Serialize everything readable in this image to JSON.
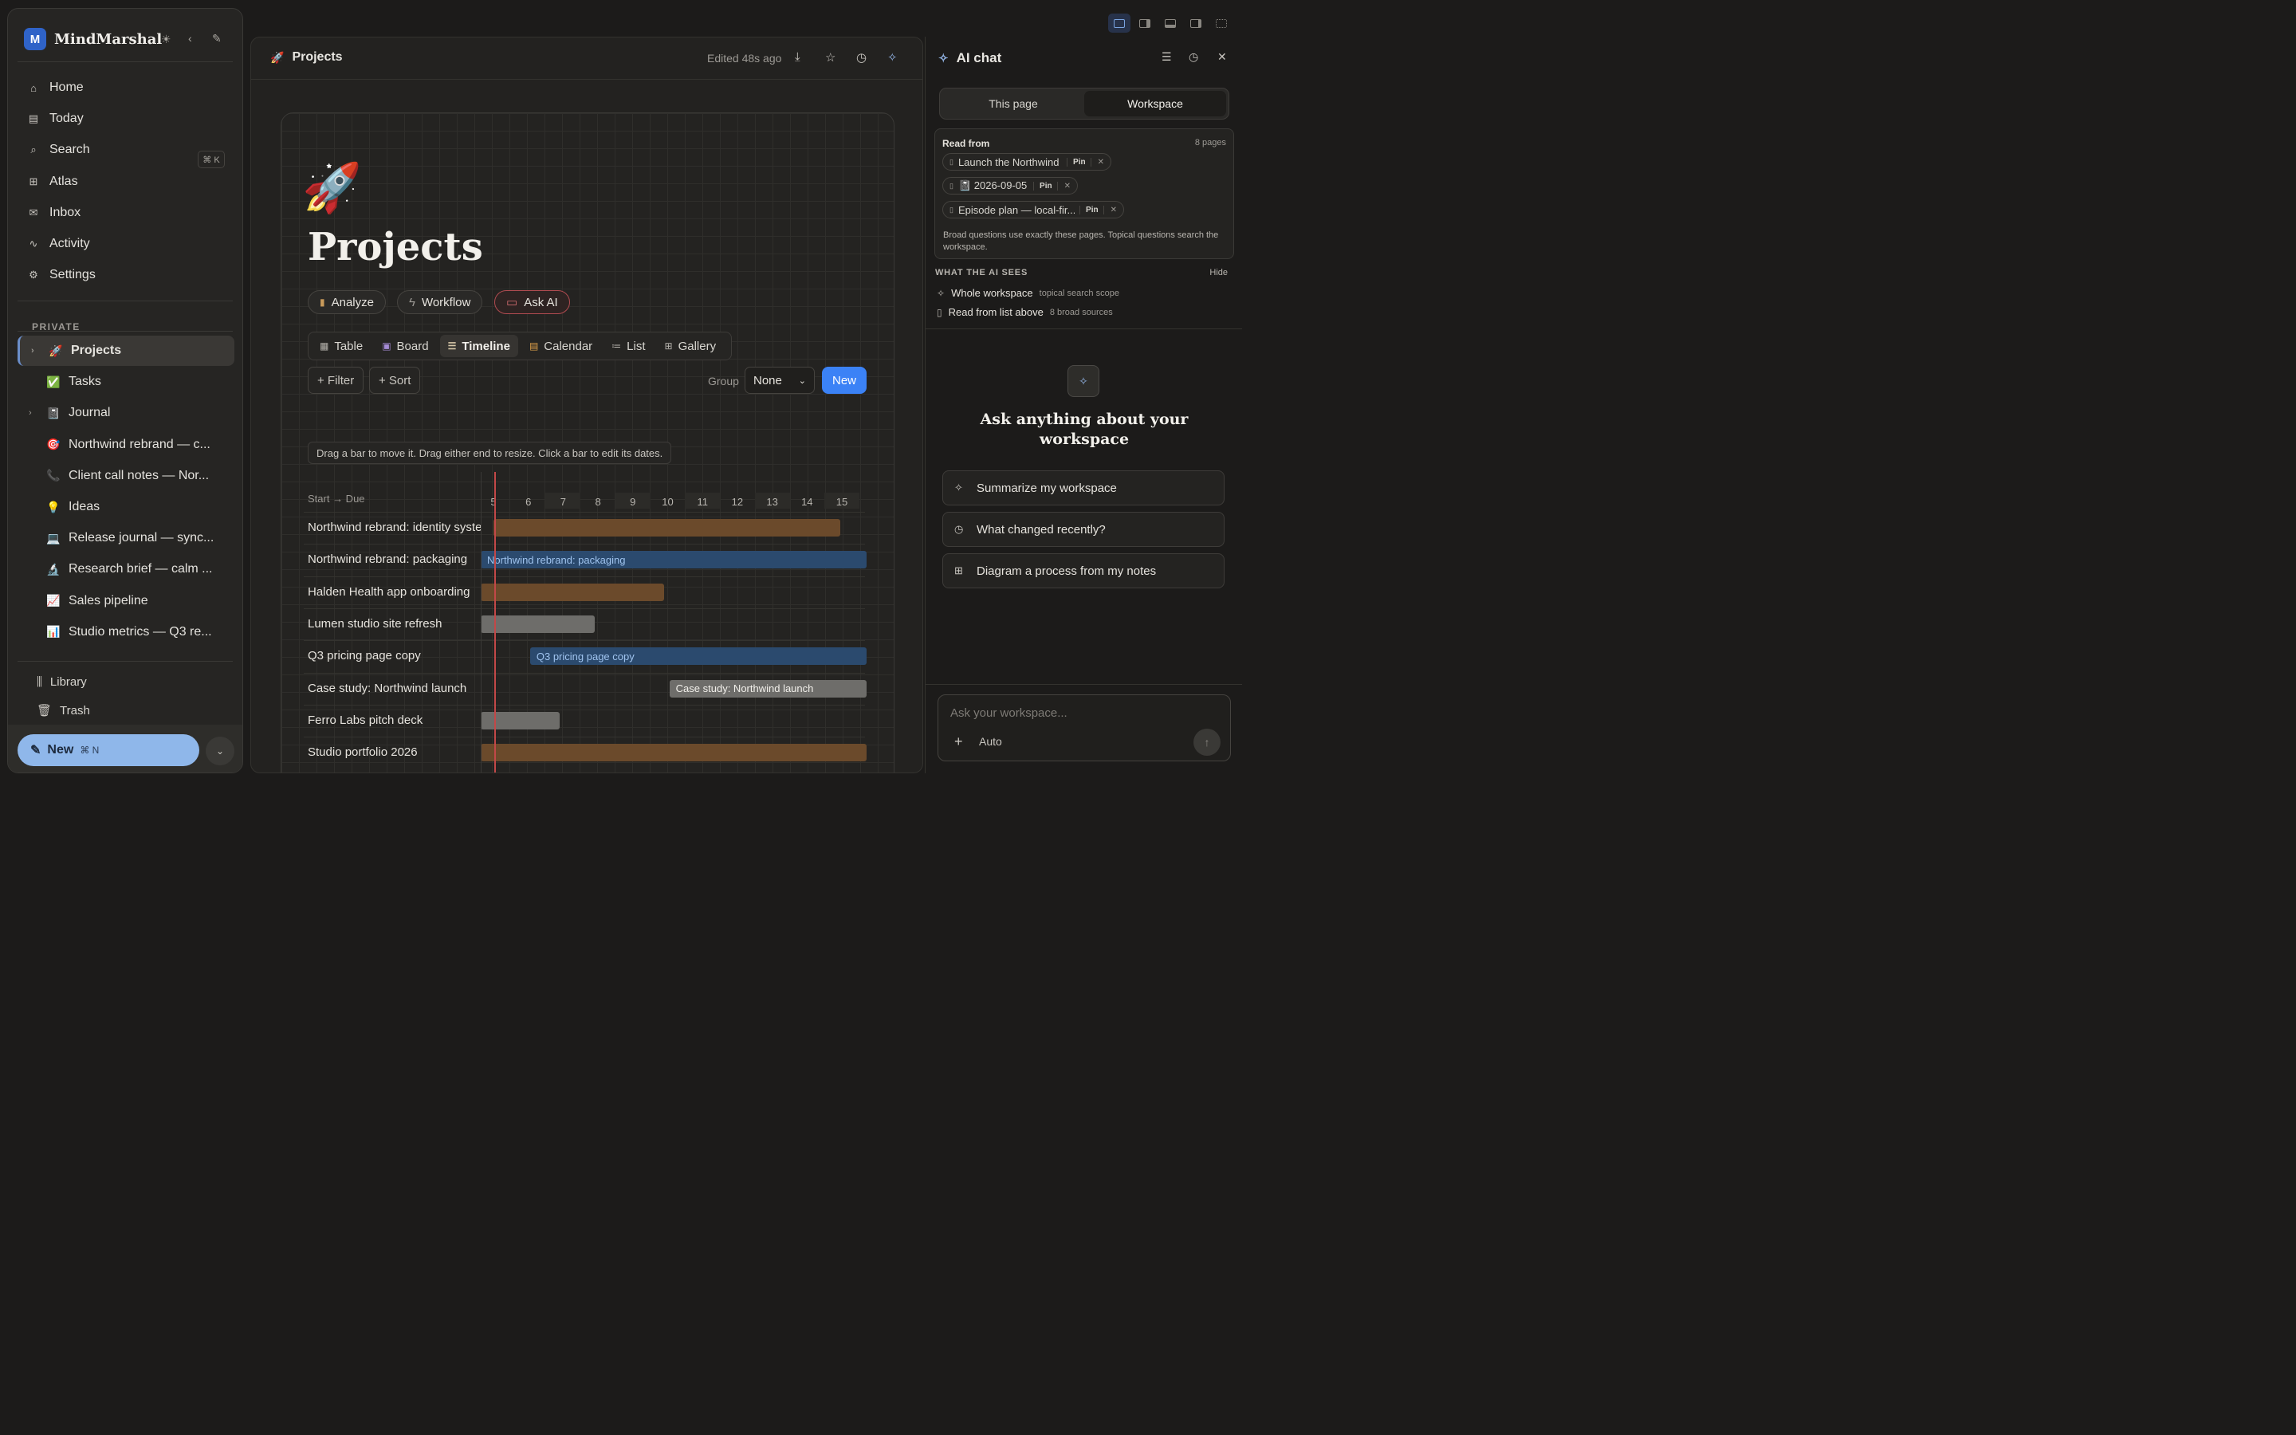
{
  "app": {
    "name": "MindMarshal"
  },
  "sidebar": {
    "nav": [
      {
        "label": "Home",
        "icon": "home-icon"
      },
      {
        "label": "Today",
        "icon": "calendar-icon"
      },
      {
        "label": "Search",
        "icon": "search-icon",
        "shortcut": "⌘ K"
      },
      {
        "label": "Atlas",
        "icon": "grid-icon"
      },
      {
        "label": "Inbox",
        "icon": "inbox-icon"
      },
      {
        "label": "Activity",
        "icon": "activity-icon"
      },
      {
        "label": "Settings",
        "icon": "gear-icon"
      }
    ],
    "section_label": "PRIVATE",
    "pages": [
      {
        "label": "Projects",
        "emoji": "🚀",
        "caret": true,
        "active": true
      },
      {
        "label": "Tasks",
        "emoji": "✅"
      },
      {
        "label": "Journal",
        "emoji": "📓",
        "caret": true
      },
      {
        "label": "Northwind rebrand — c...",
        "emoji": "🎯"
      },
      {
        "label": "Client call notes — Nor...",
        "emoji": "📞"
      },
      {
        "label": "Ideas",
        "emoji": "💡"
      },
      {
        "label": "Release journal — sync...",
        "emoji": "💻"
      },
      {
        "label": "Research brief — calm ...",
        "emoji": "🔬"
      },
      {
        "label": "Sales pipeline",
        "emoji": "📈"
      },
      {
        "label": "Studio metrics — Q3 re...",
        "emoji": "📊"
      }
    ],
    "footer": [
      {
        "label": "Library",
        "icon": "library-icon"
      },
      {
        "label": "Trash",
        "icon": "trash-icon"
      }
    ],
    "new_button": {
      "label": "New",
      "shortcut": "⌘ N"
    }
  },
  "page": {
    "title": "Projects",
    "emoji": "🚀",
    "edited": "Edited 48s ago",
    "actions": [
      {
        "label": "Analyze",
        "icon": "chart-icon"
      },
      {
        "label": "Workflow",
        "icon": "bolt-icon"
      },
      {
        "label": "Ask AI",
        "icon": "chat-icon"
      }
    ],
    "views": [
      {
        "label": "Table",
        "icon": "table-icon"
      },
      {
        "label": "Board",
        "icon": "board-icon"
      },
      {
        "label": "Timeline",
        "icon": "timeline-icon",
        "active": true
      },
      {
        "label": "Calendar",
        "icon": "calendar-icon"
      },
      {
        "label": "List",
        "icon": "list-icon"
      },
      {
        "label": "Gallery",
        "icon": "gallery-icon"
      }
    ],
    "filter_label": "+ Filter",
    "sort_label": "+ Sort",
    "group_label": "Group",
    "group_value": "None",
    "new_label": "New",
    "hint": "Drag a bar to move it. Drag either end to resize. Click a bar to edit its dates.",
    "timeline": {
      "column_header": "Start → Due",
      "ticks": [
        "5",
        "6",
        "7",
        "8",
        "9",
        "10",
        "11",
        "12",
        "13",
        "14",
        "15"
      ],
      "rows": [
        {
          "label": "Northwind rebrand: identity system",
          "start": 5.0,
          "end": 14.95,
          "color": "orange",
          "bar_text": ""
        },
        {
          "label": "Northwind rebrand: packaging",
          "start": 4.6,
          "end": 15.7,
          "color": "blue",
          "bar_text": "Northwind rebrand: packaging"
        },
        {
          "label": "Halden Health app onboarding",
          "start": 4.6,
          "end": 9.9,
          "color": "orange",
          "bar_text": ""
        },
        {
          "label": "Lumen studio site refresh",
          "start": 4.6,
          "end": 7.9,
          "color": "gray",
          "bar_text": ""
        },
        {
          "label": "Q3 pricing page copy",
          "start": 6.05,
          "end": 15.7,
          "color": "blue",
          "bar_text": "Q3 pricing page copy"
        },
        {
          "label": "Case study: Northwind launch",
          "start": 10.05,
          "end": 15.7,
          "color": "gray",
          "bar_text": "Case study: Northwind launch"
        },
        {
          "label": "Ferro Labs pitch deck",
          "start": 4.6,
          "end": 6.9,
          "color": "gray",
          "bar_text": ""
        },
        {
          "label": "Studio portfolio 2026",
          "start": 4.6,
          "end": 15.7,
          "color": "orange",
          "bar_text": ""
        }
      ]
    }
  },
  "ai_chat": {
    "title": "AI chat",
    "tabs": [
      "This page",
      "Workspace"
    ],
    "active_tab": "Workspace",
    "read_from_label": "Read from",
    "read_from_count": "8 pages",
    "sources": [
      {
        "label": "Launch the Northwind ca...",
        "pin": "Pin"
      },
      {
        "label": "📓 2026-09-05",
        "pin": "Pin"
      },
      {
        "label": "Episode plan — local-fir...",
        "pin": "Pin"
      }
    ],
    "read_from_note": "Broad questions use exactly these pages. Topical questions search the workspace.",
    "what_ai_sees_label": "WHAT THE AI SEES",
    "hide_label": "Hide",
    "scopes": [
      {
        "label": "Whole workspace",
        "sub": "topical search scope",
        "icon": "sparkle-icon"
      },
      {
        "label": "Read from list above",
        "sub": "8 broad sources",
        "icon": "document-icon"
      }
    ],
    "empty_heading": "Ask anything about your workspace",
    "suggestions": [
      {
        "label": "Summarize my workspace",
        "icon": "sparkle-icon"
      },
      {
        "label": "What changed recently?",
        "icon": "clock-icon"
      },
      {
        "label": "Diagram a process from my notes",
        "icon": "grid-icon"
      }
    ],
    "composer_placeholder": "Ask your workspace...",
    "model_label": "Auto"
  }
}
